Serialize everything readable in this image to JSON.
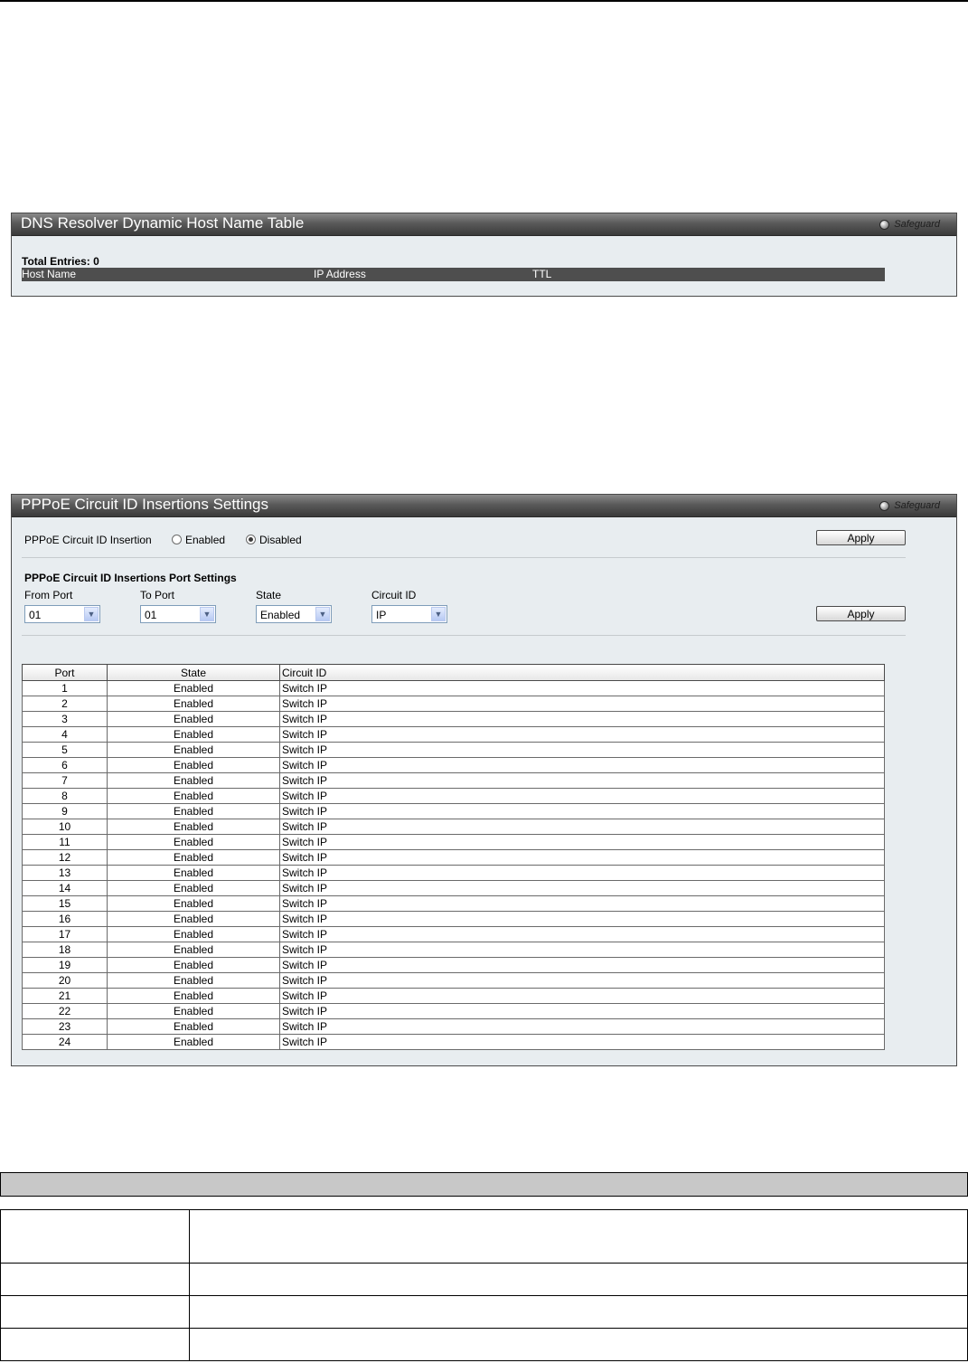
{
  "dns_panel": {
    "title": "DNS Resolver Dynamic Host Name Table",
    "safeguard": "Safeguard",
    "total_entries": "Total Entries: 0",
    "columns": [
      "Host Name",
      "IP Address",
      "TTL"
    ]
  },
  "pppoe_panel": {
    "title": "PPPoE Circuit ID Insertions Settings",
    "safeguard": "Safeguard",
    "insertion_label": "PPPoE Circuit ID Insertion",
    "radio_enabled": "Enabled",
    "radio_disabled": "Disabled",
    "selected": "Disabled",
    "apply1": "Apply",
    "port_settings_title": "PPPoE Circuit ID Insertions Port Settings",
    "from_port_label": "From Port",
    "to_port_label": "To Port",
    "state_label": "State",
    "circuit_id_label": "Circuit ID",
    "from_port_value": "01",
    "to_port_value": "01",
    "state_value": "Enabled",
    "circuit_id_value": "IP",
    "apply2": "Apply",
    "table_columns": [
      "Port",
      "State",
      "Circuit ID"
    ],
    "rows": [
      {
        "port": "1",
        "state": "Enabled",
        "cid": "Switch IP"
      },
      {
        "port": "2",
        "state": "Enabled",
        "cid": "Switch IP"
      },
      {
        "port": "3",
        "state": "Enabled",
        "cid": "Switch IP"
      },
      {
        "port": "4",
        "state": "Enabled",
        "cid": "Switch IP"
      },
      {
        "port": "5",
        "state": "Enabled",
        "cid": "Switch IP"
      },
      {
        "port": "6",
        "state": "Enabled",
        "cid": "Switch IP"
      },
      {
        "port": "7",
        "state": "Enabled",
        "cid": "Switch IP"
      },
      {
        "port": "8",
        "state": "Enabled",
        "cid": "Switch IP"
      },
      {
        "port": "9",
        "state": "Enabled",
        "cid": "Switch IP"
      },
      {
        "port": "10",
        "state": "Enabled",
        "cid": "Switch IP"
      },
      {
        "port": "11",
        "state": "Enabled",
        "cid": "Switch IP"
      },
      {
        "port": "12",
        "state": "Enabled",
        "cid": "Switch IP"
      },
      {
        "port": "13",
        "state": "Enabled",
        "cid": "Switch IP"
      },
      {
        "port": "14",
        "state": "Enabled",
        "cid": "Switch IP"
      },
      {
        "port": "15",
        "state": "Enabled",
        "cid": "Switch IP"
      },
      {
        "port": "16",
        "state": "Enabled",
        "cid": "Switch IP"
      },
      {
        "port": "17",
        "state": "Enabled",
        "cid": "Switch IP"
      },
      {
        "port": "18",
        "state": "Enabled",
        "cid": "Switch IP"
      },
      {
        "port": "19",
        "state": "Enabled",
        "cid": "Switch IP"
      },
      {
        "port": "20",
        "state": "Enabled",
        "cid": "Switch IP"
      },
      {
        "port": "21",
        "state": "Enabled",
        "cid": "Switch IP"
      },
      {
        "port": "22",
        "state": "Enabled",
        "cid": "Switch IP"
      },
      {
        "port": "23",
        "state": "Enabled",
        "cid": "Switch IP"
      },
      {
        "port": "24",
        "state": "Enabled",
        "cid": "Switch IP"
      }
    ]
  }
}
